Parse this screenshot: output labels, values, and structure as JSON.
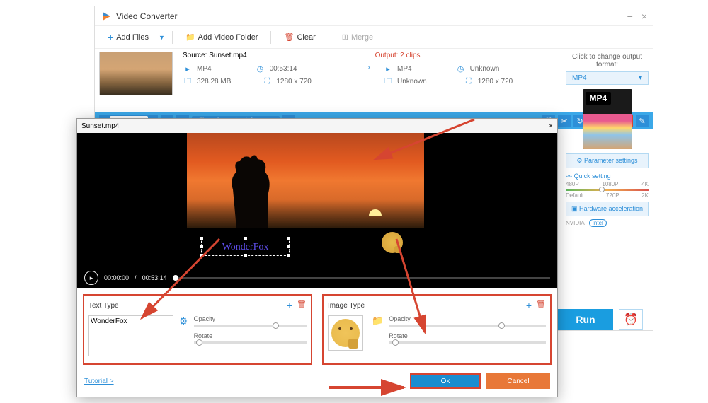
{
  "app": {
    "title": "Video Converter"
  },
  "toolbar": {
    "add_files": "Add Files",
    "add_folder": "Add Video Folder",
    "clear": "Clear",
    "merge": "Merge"
  },
  "source": {
    "label": "Source: Sunset.mp4",
    "format": "MP4",
    "duration": "00:53:14",
    "size": "328.28 MB",
    "resolution": "1280 x 720"
  },
  "output": {
    "label": "Output: 2 clips",
    "format": "MP4",
    "duration": "Unknown",
    "size": "Unknown",
    "resolution": "1280 x 720"
  },
  "bar": {
    "track_t": "T",
    "none": "None",
    "audio": "und aac (LC) (mp4a"
  },
  "right": {
    "hint": "Click to change output format:",
    "format": "MP4",
    "badge": "MP4",
    "param": "Parameter settings",
    "quick": "Quick setting",
    "presets": [
      "480P",
      "1080P",
      "4K"
    ],
    "presets2": [
      "Default",
      "720P",
      "2K"
    ],
    "hw": "Hardware acceleration",
    "nvidia": "NVIDIA",
    "intel": "Intel",
    "run": "Run"
  },
  "dialog": {
    "title": "Sunset.mp4",
    "time_cur": "00:00:00",
    "time_total": "00:53:14",
    "watermark_text": "WonderFox",
    "text_type": "Text Type",
    "image_type": "Image Type",
    "text_value": "WonderFox",
    "opacity": "Opacity",
    "rotate": "Rotate",
    "tutorial": "Tutorial >",
    "ok": "Ok",
    "cancel": "Cancel"
  }
}
